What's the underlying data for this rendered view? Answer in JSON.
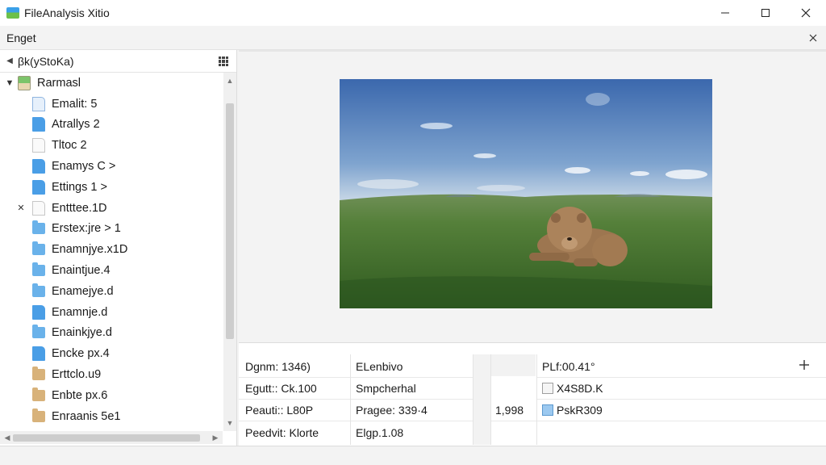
{
  "window": {
    "title": "FileAnalysis Xitio"
  },
  "menu": {
    "label": "Enget"
  },
  "sidebar": {
    "path": "βk(yStoKa)",
    "root": {
      "label": "Rarmasl"
    },
    "items": [
      {
        "label": "Emalit: 5",
        "icon": "spreadsheet-file-icon"
      },
      {
        "label": "Atrallys 2",
        "icon": "document-file-icon"
      },
      {
        "label": "Tltoc 2",
        "icon": "blank-file-icon"
      },
      {
        "label": "Enamys C >",
        "icon": "document-file-icon"
      },
      {
        "label": "Ettings 1 >",
        "icon": "document-file-icon"
      },
      {
        "label": "Entttee.1D",
        "icon": "blank-file-icon",
        "marked": "✕"
      },
      {
        "label": "Erstex:jre > 1",
        "icon": "folder-icon"
      },
      {
        "label": "Enamnjye.x1D",
        "icon": "folder-icon"
      },
      {
        "label": "Enaintjue.4",
        "icon": "folder-icon"
      },
      {
        "label": "Enamejye.d",
        "icon": "folder-icon"
      },
      {
        "label": "Enamnje.d",
        "icon": "document-file-icon"
      },
      {
        "label": "Enainkjye.d",
        "icon": "folder-icon"
      },
      {
        "label": "Encke px.4",
        "icon": "document-file-icon"
      },
      {
        "label": "Erttclo.u9",
        "icon": "folder-tan-icon"
      },
      {
        "label": "Enbte px.6",
        "icon": "folder-tan-icon"
      },
      {
        "label": "Enraanis 5e1",
        "icon": "folder-tan-icon"
      }
    ]
  },
  "preview": {
    "image_description_icon": "landscape-bear-image",
    "colors": {
      "sky_top": "#3f6db2",
      "sky_bottom": "#b9cfe3",
      "grass": "#4f7a2e",
      "bear": "#a27a52"
    }
  },
  "details": {
    "col1": [
      "Dgnm: 1346)",
      "Egutt:: Ck.100",
      "Peauti:: L80P",
      "Peedvit: Klorte"
    ],
    "col2": [
      "ELenbivo",
      "Smpcherhal",
      "Pragee: 339·4",
      "Elgp.1.08"
    ],
    "col3": [
      "",
      "",
      "1,998",
      ""
    ],
    "col4": [
      "PLf:00.41°",
      "X4S8D.K",
      "PskR309",
      ""
    ]
  }
}
